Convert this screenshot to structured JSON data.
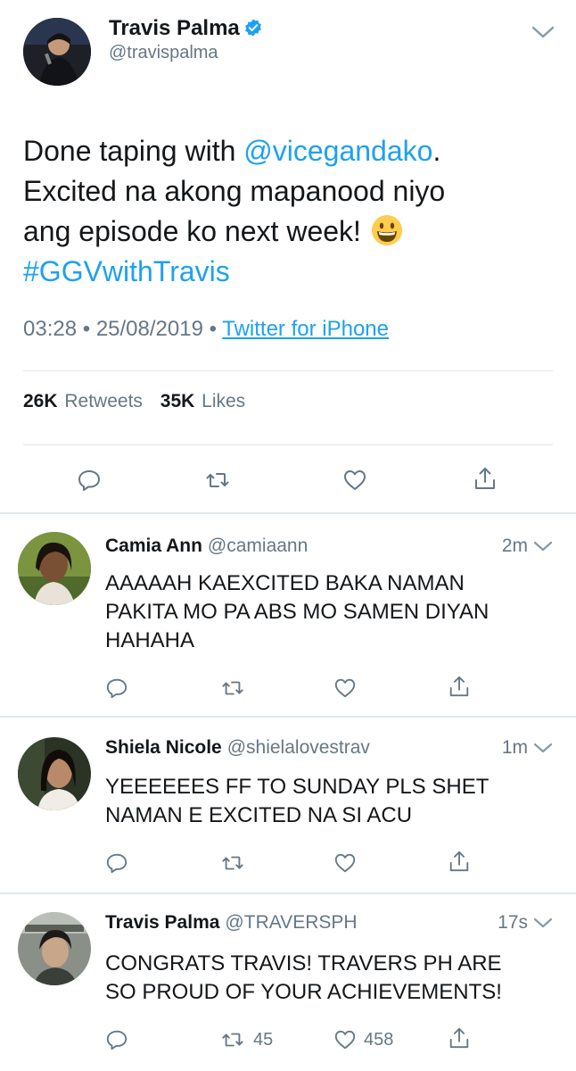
{
  "main_tweet": {
    "author_name": "Travis Palma",
    "author_handle": "@travispalma",
    "verified_icon": "verified-badge-icon",
    "text_before": "Done taping with ",
    "mention": "@vicegandako",
    "text_after_1": ".",
    "text_line2": "Excited na akong mapanood niyo",
    "text_line3": "ang episode ko next week!",
    "hashtag": "#GGVwithTravis",
    "time": "03:28",
    "date": "25/08/2019",
    "source": "Twitter for iPhone",
    "retweets_count": "26K",
    "retweets_label": "Retweets",
    "likes_count": "35K",
    "likes_label": "Likes",
    "colors": {
      "link": "#1da1f2",
      "secondary": "#657786",
      "divider": "#e1e8ed"
    }
  },
  "replies": [
    {
      "name": "Camia Ann",
      "handle": "@camiaann",
      "time": "2m",
      "text_lines": [
        "AAAAAH KAEXCITED BAKA NAMAN",
        "PAKITA MO PA ABS MO SAMEN DIYAN",
        "HAHAHA"
      ]
    },
    {
      "name": "Shiela Nicole",
      "handle": "@shielalovestrav",
      "time": "1m",
      "text_lines": [
        "YEEEEEES FF TO SUNDAY PLS SHET",
        "NAMAN E EXCITED NA SI ACU"
      ]
    },
    {
      "name": "Travis Palma",
      "handle": "@TRAVERSPH",
      "time": "17s",
      "text_lines": [
        "CONGRATS TRAVIS! TRAVERS PH ARE",
        "SO PROUD OF YOUR ACHIEVEMENTS!"
      ],
      "retweet_count": "45",
      "like_count": "458"
    }
  ]
}
